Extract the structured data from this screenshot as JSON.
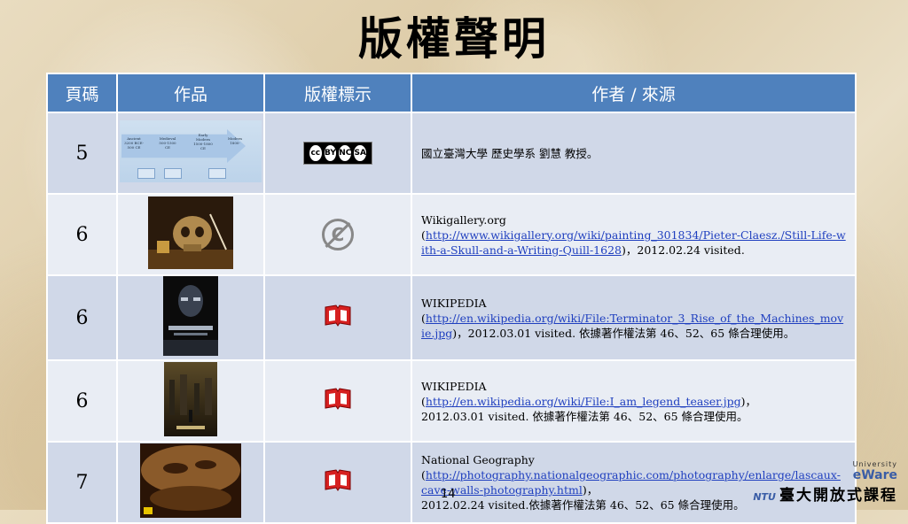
{
  "title": "版權聲明",
  "table": {
    "headers": [
      "頁碼",
      "作品",
      "版權標示",
      "作者 / 來源"
    ],
    "rows": [
      {
        "page": "5",
        "thumb": "timeline",
        "license": "cc-by-nc-sa",
        "license_text": [
          "BY",
          "NC",
          "SA"
        ],
        "source_lines": [
          "國立臺灣大學 歷史學系 劉慧 教授。"
        ],
        "link": "",
        "after": "",
        "extra": ""
      },
      {
        "page": "6",
        "thumb": "painting",
        "license": "public-domain",
        "source_lines": [
          "Wikigallery.org"
        ],
        "link": "http://www.wikigallery.org/wiki/painting_301834/Pieter-Claesz./Still-Life-with-a-Skull-and-a-Writing-Quill-1628",
        "after": "，2012.02.24 visited.",
        "extra": ""
      },
      {
        "page": "6",
        "thumb": "poster-terminator",
        "license": "fair-use",
        "source_lines": [
          "WIKIPEDIA"
        ],
        "link": "http://en.wikipedia.org/wiki/File:Terminator_3_Rise_of_the_Machines_movie.jpg",
        "after": "，2012.03.01 visited. 依據著作權法第 46、52、65 條合理使用。",
        "extra": ""
      },
      {
        "page": "6",
        "thumb": "poster-legend",
        "license": "fair-use",
        "source_lines": [
          "WIKIPEDIA"
        ],
        "link": "http://en.wikipedia.org/wiki/File:I_am_legend_teaser.jpg",
        "after": "，",
        "extra": "2012.03.01 visited. 依據著作權法第 46、52、65 條合理使用。"
      },
      {
        "page": "7",
        "thumb": "cave",
        "license": "fair-use",
        "source_lines": [
          "National Geography"
        ],
        "link": "http://photography.nationalgeographic.com/photography/enlarge/lascaux-cave-walls-photography.html",
        "after": "，",
        "extra": "2012.02.24 visited.依據著作權法第 46、52、65 條合理使用。"
      }
    ]
  },
  "timeline": {
    "segments": [
      "Ancient 3200 BCE-500 CE",
      "Medieval 500-1500 CE",
      "Early Modern 1500-1800 CE",
      "Modern 1800-"
    ]
  },
  "page_number": "14",
  "logo": {
    "university": "University",
    "courseware": "eWare",
    "ntu": "NTU",
    "name": "臺大開放式課程"
  },
  "colors": {
    "header": "#4f81bd",
    "row_odd": "#d0d8e8",
    "row_even": "#e9edf4",
    "link": "#1f3fbf",
    "fair_use_icon": "#d62020"
  }
}
